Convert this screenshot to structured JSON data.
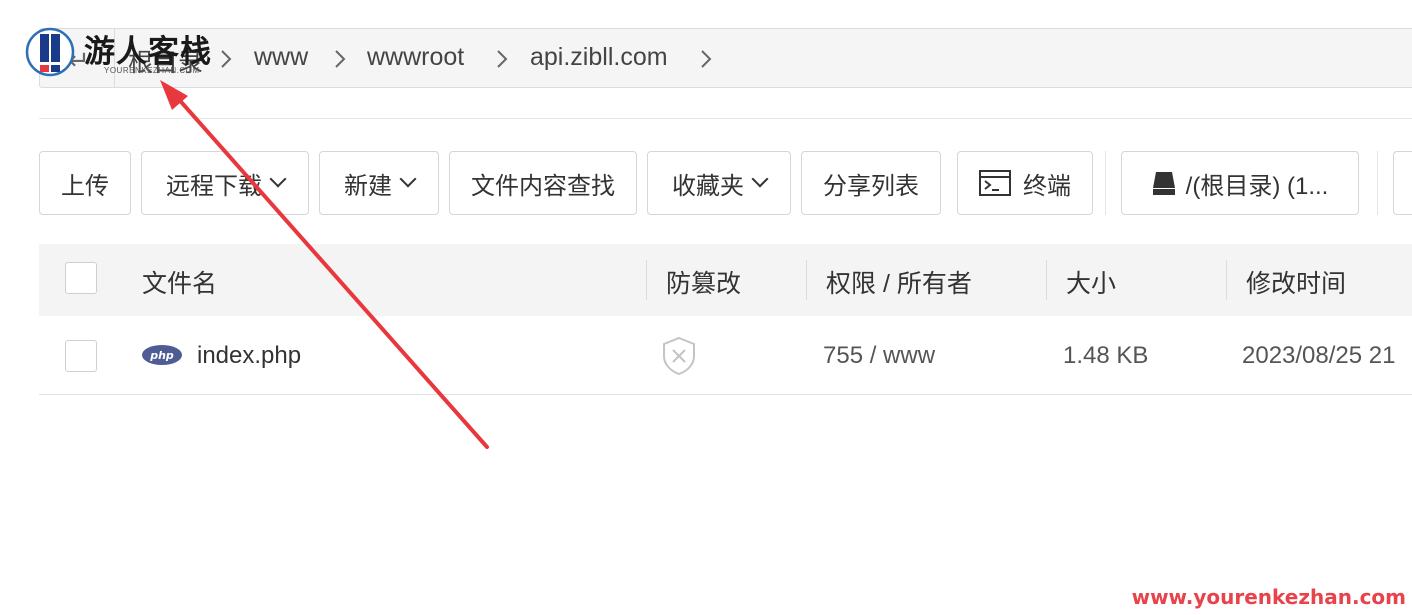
{
  "watermark": {
    "logo_text": "游人客栈",
    "logo_sub": "YOURENKEZHAN.COM",
    "url": "www.yourenkezhan.com"
  },
  "breadcrumb": {
    "items": [
      "根目录",
      "www",
      "wwwroot",
      "api.zibll.com"
    ]
  },
  "toolbar": {
    "upload": "上传",
    "remote_download": "远程下载",
    "new": "新建",
    "content_search": "文件内容查找",
    "favorites": "收藏夹",
    "share_list": "分享列表",
    "terminal": "终端",
    "disk": "/(根目录) (1..."
  },
  "table": {
    "headers": {
      "name": "文件名",
      "tamper": "防篡改",
      "permission": "权限 / 所有者",
      "size": "大小",
      "modified": "修改时间"
    },
    "rows": [
      {
        "name": "index.php",
        "icon_label": "php",
        "permission": "755 / www",
        "size": "1.48 KB",
        "modified": "2023/08/25 21"
      }
    ]
  },
  "colors": {
    "arrow": "#e8383d",
    "php_badge": "#4f5b93",
    "watermark": "#e8424b"
  }
}
